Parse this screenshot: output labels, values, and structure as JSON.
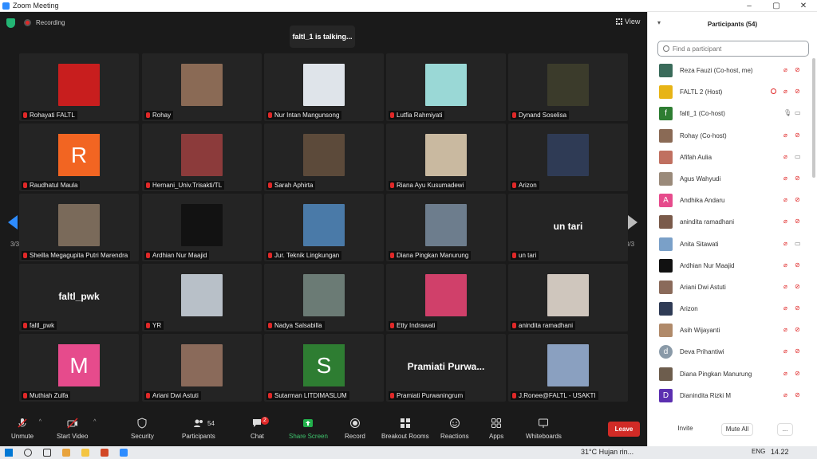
{
  "window": {
    "title": "Zoom Meeting",
    "controls": [
      "–",
      "▢",
      "✕"
    ]
  },
  "topbar": {
    "recording": "Recording",
    "talking": "faltl_1 is talking...",
    "view": "View"
  },
  "pager": {
    "page": "3/3"
  },
  "tiles": [
    {
      "name": "Rohayati FALTL",
      "kind": "photo",
      "color": "#c81e1e"
    },
    {
      "name": "Rohay",
      "kind": "photo",
      "color": "#8a6a55"
    },
    {
      "name": "Nur Intan Mangunsong",
      "kind": "photo",
      "color": "#dfe4ea"
    },
    {
      "name": "Lutfia Rahmiyati",
      "kind": "photo",
      "color": "#9ad8d6"
    },
    {
      "name": "Dynand Soselisa",
      "kind": "photo",
      "color": "#3b3b2b"
    },
    {
      "name": "Raudhatul Maula",
      "kind": "letter",
      "letter": "R",
      "color": "#f26522"
    },
    {
      "name": "Hernani_Univ.Trisakti/TL",
      "kind": "photo",
      "color": "#8c3b3b"
    },
    {
      "name": "Sarah Aphirta",
      "kind": "photo",
      "color": "#5c4a3a"
    },
    {
      "name": "Riana Ayu Kusumadewi",
      "kind": "photo",
      "color": "#c9b9a0"
    },
    {
      "name": "Arizon",
      "kind": "photo",
      "color": "#2f3b55"
    },
    {
      "name": "Sheilla Megagupita Putri Marendra",
      "kind": "photo",
      "color": "#7a6a5a"
    },
    {
      "name": "Ardhian Nur Maajid",
      "kind": "photo",
      "color": "#121212"
    },
    {
      "name": "Jur. Teknik Lingkungan",
      "kind": "photo",
      "color": "#4a7aa8"
    },
    {
      "name": "Diana Pingkan Manurung",
      "kind": "photo",
      "color": "#6d7d8d"
    },
    {
      "name": "un tari",
      "kind": "text",
      "label": "un tari"
    },
    {
      "name": "faltl_pwk",
      "kind": "text",
      "label": "faltl_pwk"
    },
    {
      "name": "YR",
      "kind": "photo",
      "color": "#b8c0c8"
    },
    {
      "name": "Nadya Salsabilla",
      "kind": "photo",
      "color": "#6b7b75"
    },
    {
      "name": "Etty Indrawati",
      "kind": "photo",
      "color": "#d0406a"
    },
    {
      "name": "anindita ramadhani",
      "kind": "photo",
      "color": "#cfc6bd"
    },
    {
      "name": "Muthiah Zulfa",
      "kind": "letter",
      "letter": "M",
      "color": "#e64b8c"
    },
    {
      "name": "Ariani Dwi Astuti",
      "kind": "photo",
      "color": "#8a6a5a"
    },
    {
      "name": "Sutarman LITDIMASLUM",
      "kind": "letter",
      "letter": "S",
      "color": "#2e7d32"
    },
    {
      "name": "Pramiati Purwaningrum",
      "kind": "text",
      "label": "Pramiati  Purwa..."
    },
    {
      "name": "J.Ronee@FALTL - USAKTI",
      "kind": "photo",
      "color": "#8aa0c0"
    }
  ],
  "toolbar": {
    "unmute": "Unmute",
    "start_video": "Start Video",
    "security": "Security",
    "participants": "Participants",
    "participants_count": "54",
    "chat": "Chat",
    "chat_badge": "2",
    "share": "Share Screen",
    "record": "Record",
    "breakout": "Breakout Rooms",
    "reactions": "Reactions",
    "apps": "Apps",
    "whiteboards": "Whiteboards",
    "leave": "Leave"
  },
  "panel": {
    "title": "Participants (54)",
    "search_placeholder": "Find a participant",
    "invite": "Invite",
    "mute_all": "Mute All",
    "more": "...",
    "rows": [
      {
        "name": "Reza Fauzi (Co-host, me)",
        "av": "#3a6b5a",
        "letter": "",
        "mic": "off",
        "cam": "off"
      },
      {
        "name": "FALTL 2 (Host)",
        "av": "#e7b416",
        "letter": "",
        "mic": "off",
        "cam": "off",
        "rec": true
      },
      {
        "name": "faltl_1 (Co-host)",
        "av": "#2e7d32",
        "letter": "f",
        "mic": "on",
        "cam": "offg"
      },
      {
        "name": "Rohay (Co-host)",
        "av": "#8a6a55",
        "letter": "",
        "mic": "off",
        "cam": "off"
      },
      {
        "name": "Afifah Aulia",
        "av": "#c07060",
        "letter": "",
        "mic": "off",
        "cam": "on"
      },
      {
        "name": "Agus Wahyudi",
        "av": "#9a8a7a",
        "letter": "",
        "mic": "off",
        "cam": "off"
      },
      {
        "name": "Andhika Andaru",
        "av": "#e64b8c",
        "letter": "A",
        "mic": "off",
        "cam": "off"
      },
      {
        "name": "anindita ramadhani",
        "av": "#7a5a4a",
        "letter": "",
        "mic": "off",
        "cam": "off"
      },
      {
        "name": "Anita Sitawati",
        "av": "#7aa0c8",
        "letter": "",
        "mic": "off",
        "cam": "on"
      },
      {
        "name": "Ardhian Nur Maajid",
        "av": "#111111",
        "letter": "",
        "mic": "off",
        "cam": "off"
      },
      {
        "name": "Ariani Dwi Astuti",
        "av": "#8a6a5a",
        "letter": "",
        "mic": "off",
        "cam": "off"
      },
      {
        "name": "Arizon",
        "av": "#2f3b55",
        "letter": "",
        "mic": "off",
        "cam": "off"
      },
      {
        "name": "Asih Wijayanti",
        "av": "#b08a6a",
        "letter": "",
        "mic": "off",
        "cam": "off"
      },
      {
        "name": "Deva Prihantiwi",
        "av": "#8a9aa8",
        "letter": "d",
        "mic": "off",
        "cam": "off"
      },
      {
        "name": "Diana Pingkan Manurung",
        "av": "#6d5d4d",
        "letter": "",
        "mic": "off",
        "cam": "off"
      },
      {
        "name": "Dianindita Rizki M",
        "av": "#5b2fb0",
        "letter": "D",
        "mic": "off",
        "cam": "off"
      }
    ]
  },
  "taskbar": {
    "weather": "31°C  Hujan rin...",
    "lang": "ENG",
    "time": "14.22"
  }
}
